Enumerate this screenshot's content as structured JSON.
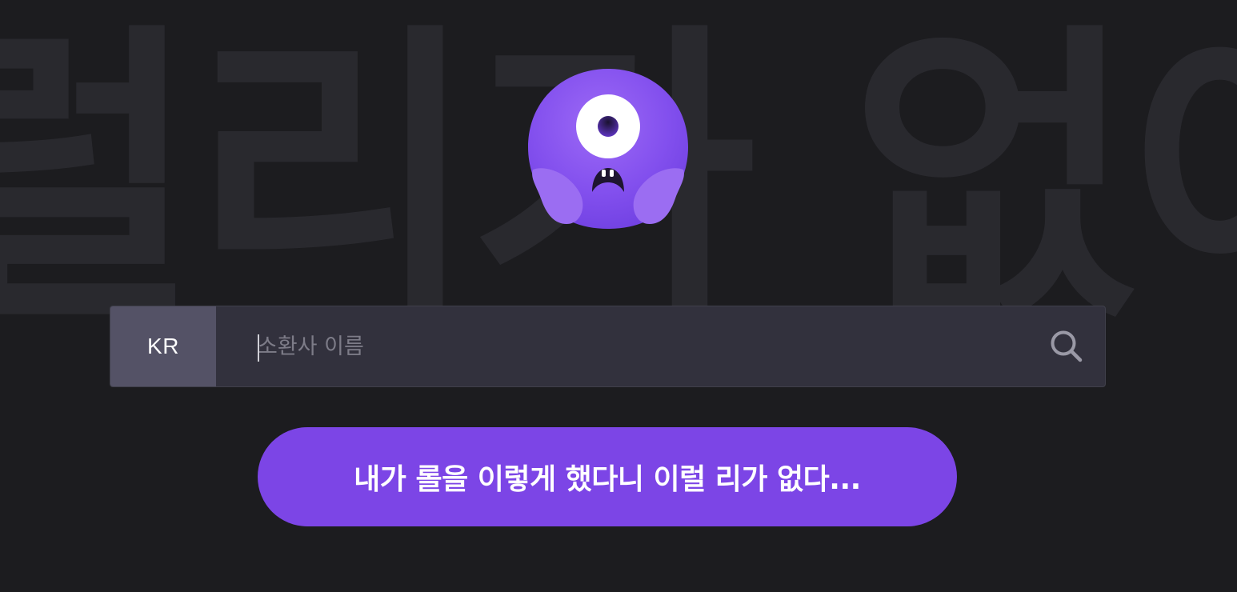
{
  "background": {
    "watermark_text": "럴리가 없어"
  },
  "search": {
    "region_label": "KR",
    "placeholder": "소환사 이름",
    "value": ""
  },
  "cta": {
    "label": "내가 롤을 이렇게 했다니 이럴 리가 없다..."
  },
  "colors": {
    "page_background": "#1c1c1f",
    "watermark": "#29292e",
    "search_bar": "#32313d",
    "region_button": "#545266",
    "accent": "#7c45e6",
    "mascot": "#8a55f0"
  },
  "icons": {
    "search": "search-icon",
    "mascot": "one-eyed-purple-monster"
  }
}
